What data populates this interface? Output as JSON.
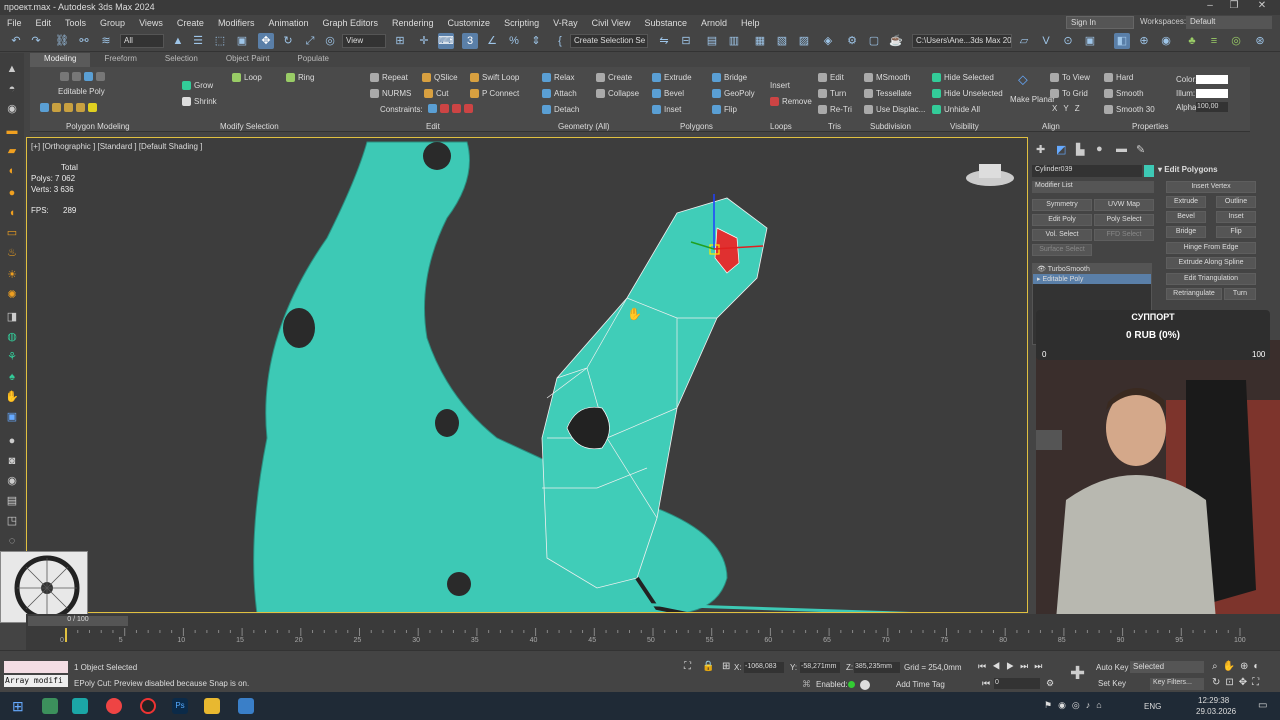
{
  "window": {
    "title": "проект.max - Autodesk 3ds Max 2024"
  },
  "menu": [
    "File",
    "Edit",
    "Tools",
    "Group",
    "Views",
    "Create",
    "Modifiers",
    "Animation",
    "Graph Editors",
    "Rendering",
    "Customize",
    "Scripting",
    "V-Ray",
    "Civil View",
    "Substance",
    "Arnold",
    "Help"
  ],
  "account": {
    "signin": "Sign In",
    "workspaces_label": "Workspaces:",
    "workspace": "Default"
  },
  "toolbar": {
    "filter": "All",
    "view": "View",
    "selection_set": "Create Selection Se",
    "path": "C:\\Users\\Ane...3ds Max 2024"
  },
  "ribbon": {
    "tabs": [
      "Modeling",
      "Freeform",
      "Selection",
      "Object Paint",
      "Populate"
    ],
    "groups": [
      "Polygon Modeling",
      "Modify Selection",
      "Edit",
      "Geometry (All)",
      "Polygons",
      "Loops",
      "Tris",
      "Subdivision",
      "Visibility",
      "Align",
      "Properties"
    ],
    "editable_poly": "Editable Poly",
    "grow": "Grow",
    "shrink": "Shrink",
    "loop": "Loop",
    "ring": "Ring",
    "repeat": "Repeat",
    "qslice": "QSlice",
    "swift_loop": "Swift Loop",
    "nurms": "NURMS",
    "cut": "Cut",
    "p_connect": "P Connect",
    "constraints": "Constraints:",
    "relax": "Relax",
    "create": "Create",
    "attach": "Attach",
    "collapse": "Collapse",
    "detach": "Detach",
    "extrude": "Extrude",
    "bridge": "Bridge",
    "bevel": "Bevel",
    "geopoly": "GeoPoly",
    "inset": "Inset",
    "flip": "Flip",
    "insert": "Insert",
    "remove": "Remove",
    "edit": "Edit",
    "turn": "Turn",
    "retri": "Re-Tri",
    "msmooth": "MSmooth",
    "tessellate": "Tessellate",
    "use_displac": "Use Displac...",
    "hide_selected": "Hide Selected",
    "hide_unselected": "Hide Unselected",
    "unhide_all": "Unhide All",
    "make_planar": "Make Planar",
    "to_view": "To View",
    "to_grid": "To Grid",
    "hard": "Hard",
    "smooth": "Smooth",
    "smooth30": "Smooth 30",
    "color": "Color:",
    "illum": "Illum:",
    "alpha": "Alpha:",
    "alpha_value": "100,00"
  },
  "viewport": {
    "label": "[+] [Orthographic ] [Standard ] [Default Shading ]",
    "total": "Total",
    "polys_label": "Polys:",
    "polys": "7 062",
    "verts_label": "Verts:",
    "verts": "3 636",
    "fps_label": "FPS:",
    "fps": "289"
  },
  "command_panel": {
    "object_name": "Cylinder039",
    "modifier_list": "Modifier List",
    "buttons": [
      "Symmetry",
      "UVW Map",
      "Edit Poly",
      "Poly Select",
      "Vol. Select",
      "FFD Select",
      "Surface Select"
    ],
    "stack": [
      "TurboSmooth",
      "Editable Poly"
    ],
    "rollout_title": "Edit Polygons",
    "insert_vertex": "Insert Vertex",
    "extrude": "Extrude",
    "outline": "Outline",
    "bevel": "Bevel",
    "inset": "Inset",
    "bridge": "Bridge",
    "flip": "Flip",
    "hinge": "Hinge From Edge",
    "extrude_spline": "Extrude Along Spline",
    "edit_tri": "Edit Triangulation",
    "retriangulate": "Retriangulate",
    "turn": "Turn"
  },
  "donation": {
    "title": "СУППОРТ",
    "amount": "0 RUB (0%)",
    "min": "0",
    "max": "100"
  },
  "timeline": {
    "ticks": [
      "0",
      "5",
      "10",
      "15",
      "20",
      "25",
      "30",
      "35",
      "40",
      "45",
      "50",
      "55",
      "60",
      "65",
      "70",
      "75",
      "80",
      "85",
      "90",
      "95",
      "100"
    ],
    "frame": "0 / 100"
  },
  "status": {
    "selected": "1 Object Selected",
    "message": "EPoly Cut: Preview disabled because Snap is on.",
    "script": "Array modifi",
    "x_label": "X:",
    "x": "-1068,083",
    "y_label": "Y:",
    "y": "-58,271mm",
    "z_label": "Z:",
    "z": "385,235mm",
    "grid": "Grid = 254,0mm",
    "enabled": "Enabled:",
    "add_time_tag": "Add Time Tag",
    "auto_key": "Auto Key",
    "set_key": "Set Key",
    "selected_opt": "Selected",
    "key_filters": "Key Filters...",
    "frame": "0"
  },
  "taskbar": {
    "time": "12:29:38",
    "date": "29.03.2026",
    "lang": "ENG"
  },
  "colors": {
    "mesh": "#40c8b4",
    "viewport_border": "#e0c040",
    "accent": "#5a9fd4"
  }
}
